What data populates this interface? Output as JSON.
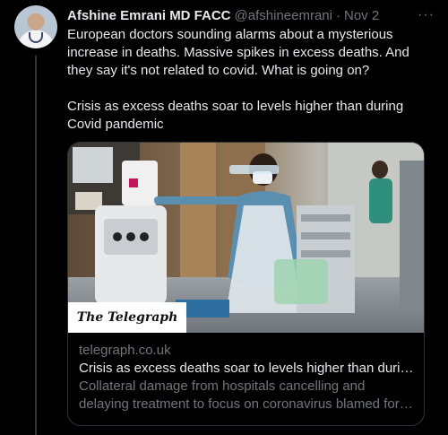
{
  "tweet": {
    "author_name": "Afshine Emrani MD FACC",
    "handle": "@afshineemrani",
    "separator": "·",
    "date": "Nov 2",
    "more_label": "···",
    "text_paragraphs": [
      "European doctors sounding alarms about a mysterious increase in deaths.  Massive spikes in excess deaths. And they say it's not related to covid. What is going on?",
      "Crisis as excess deaths soar to levels higher than during Covid pandemic"
    ]
  },
  "card": {
    "publisher_badge": "The Telegraph",
    "domain": "telegraph.co.uk",
    "title": "Crisis as excess deaths soar to levels higher than during Covid pandemic",
    "description": "Collateral damage from hospitals cancelling and delaying treatment to focus on coronavirus blamed for mortality spike"
  },
  "colors": {
    "background": "#000000",
    "text_primary": "#e7e9ea",
    "text_secondary": "#71767b",
    "border": "#2f3336"
  },
  "icons": {
    "more": "more-horizontal-icon"
  }
}
